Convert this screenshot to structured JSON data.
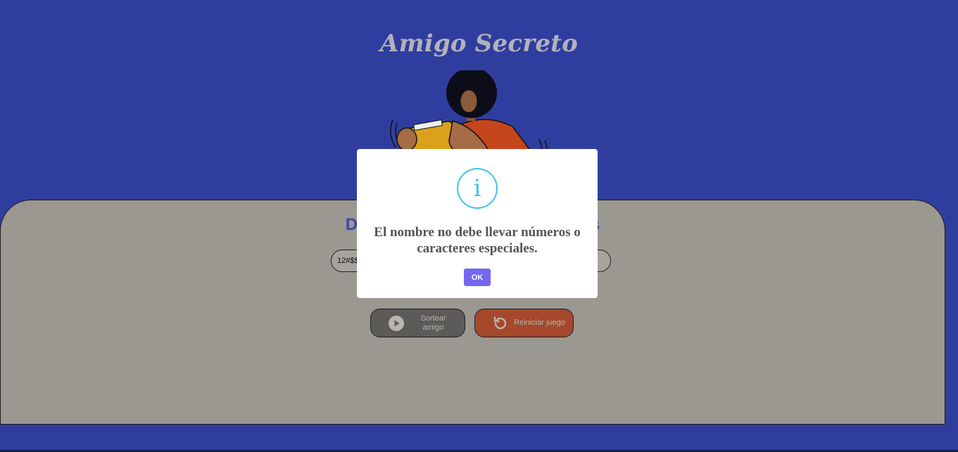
{
  "page": {
    "title": "Amigo Secreto"
  },
  "card": {
    "heading": "Digite el nombre de sus amigos",
    "input_value": "12#$$",
    "draw_button": {
      "label": "Sortear amigo",
      "icon": "play-circle-icon"
    },
    "reset_button": {
      "label": "Reiniciar juego",
      "icon": "refresh-icon"
    }
  },
  "alert": {
    "icon": "info-icon",
    "icon_glyph": "i",
    "message": "El nombre no debe llevar números o caracteres especiales.",
    "ok_label": "OK"
  },
  "colors": {
    "background": "#2f3e9e",
    "card": "#9b9791",
    "info": "#3fc3ee",
    "confirm": "#7367f0",
    "reset": "#a6482b"
  }
}
